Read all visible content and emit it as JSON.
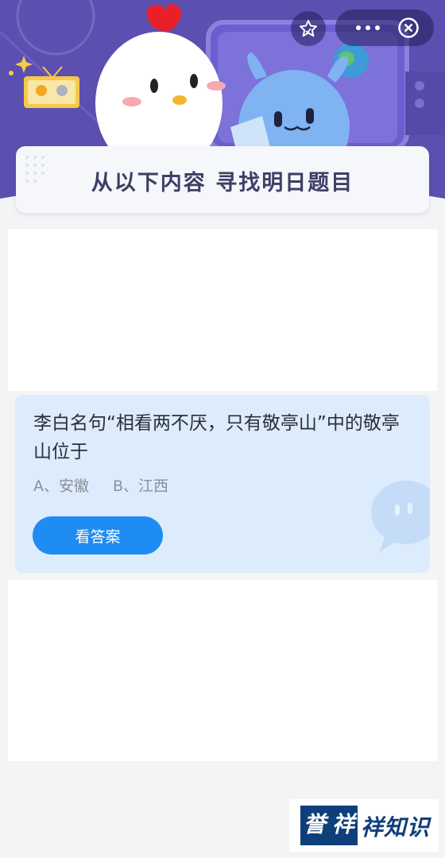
{
  "header": {
    "banner_title": "从以下内容  寻找明日题目"
  },
  "question": {
    "text": "李白名句“相看两不厌，只有敬亭山”中的敬亭山位于",
    "options": [
      "A、安徽",
      "B、江西"
    ],
    "answer_button_label": "看答案"
  },
  "watermark": {
    "mark_chars": [
      "誉",
      "祥"
    ],
    "text": "祥知识"
  },
  "icons": {
    "favorite": "star-icon",
    "more": "more-dots-icon",
    "close": "close-circle-icon"
  },
  "colors": {
    "header_bg": "#5b4fb0",
    "card_bg": "#dcecfd",
    "button": "#1e8cf3",
    "brand": "#0f3f7a"
  }
}
